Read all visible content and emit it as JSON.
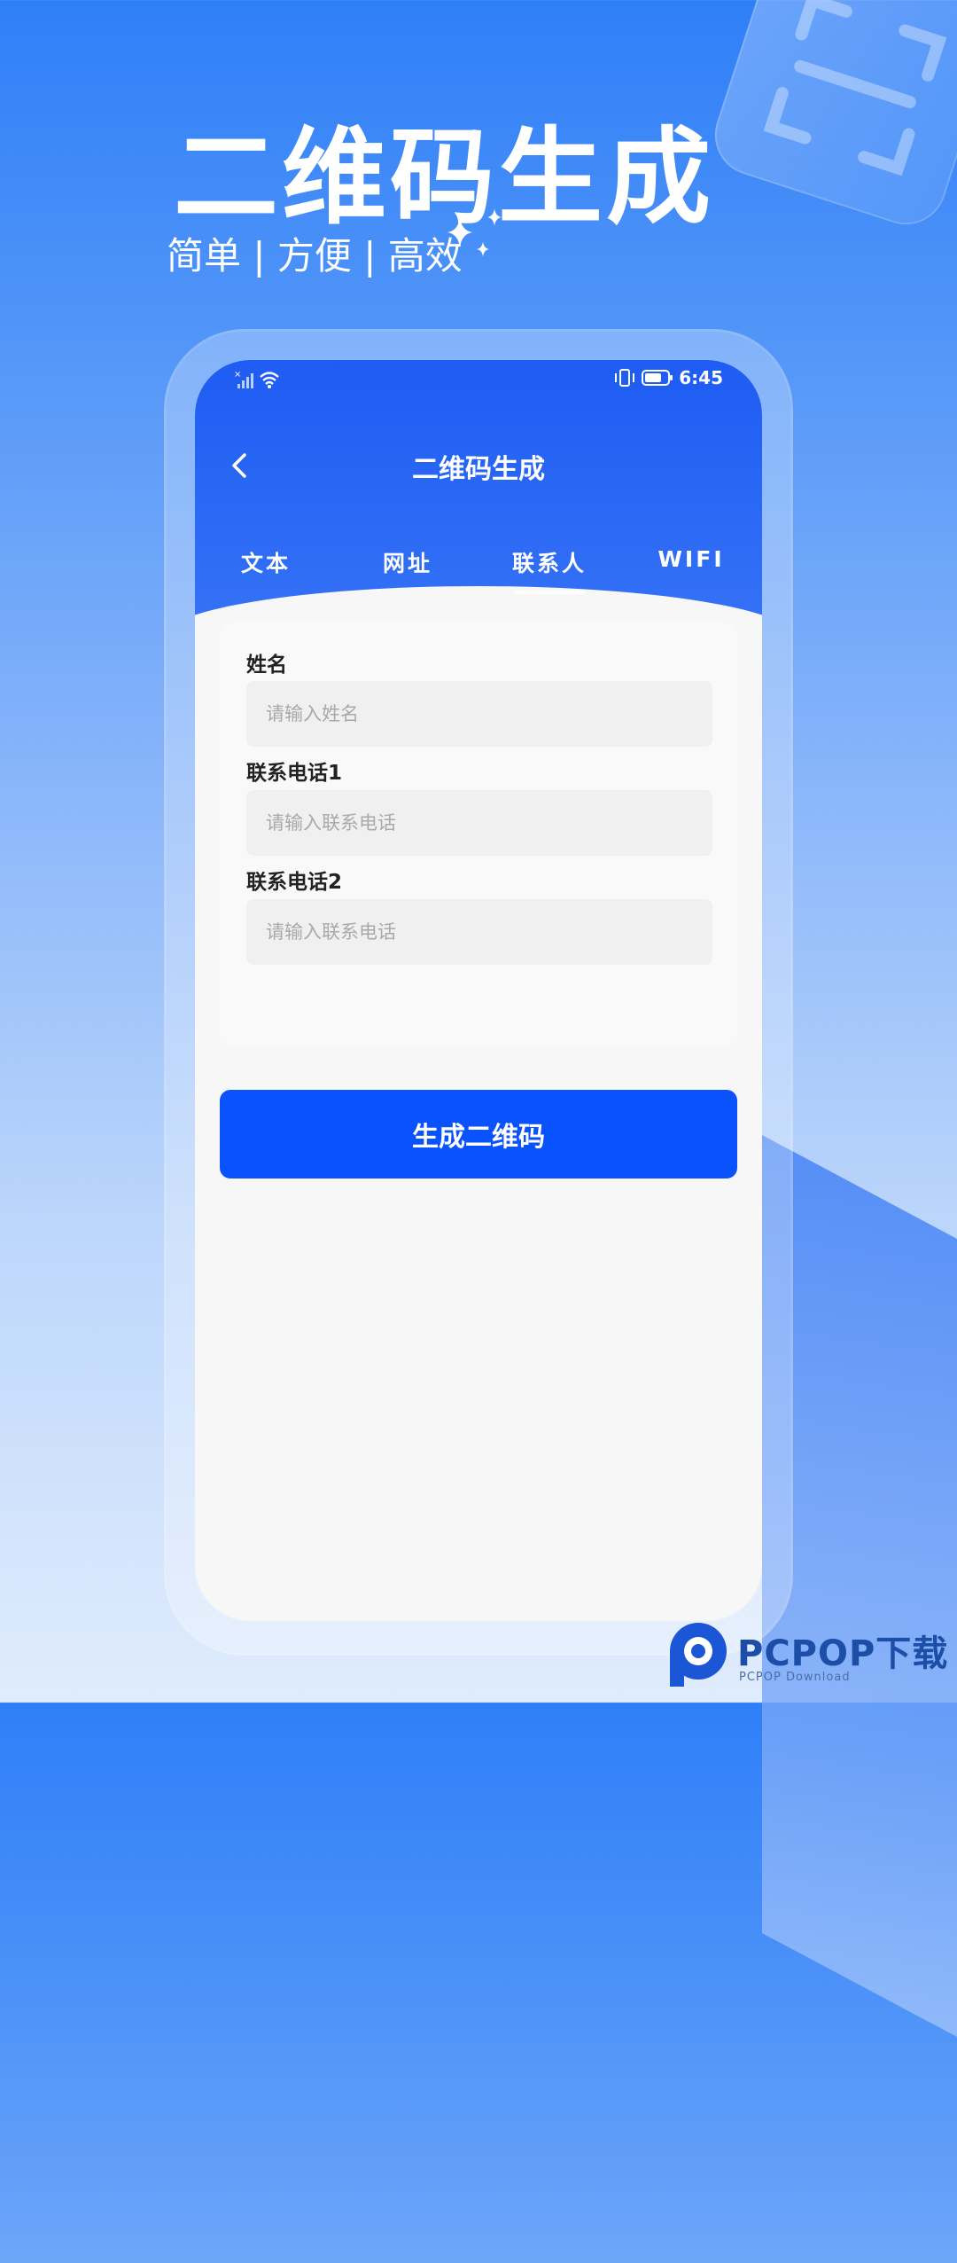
{
  "hero": {
    "title": "二维码生成",
    "subtitle": "简单 | 方便 | 高效"
  },
  "status_bar": {
    "time": "6:45"
  },
  "app": {
    "title": "二维码生成",
    "tabs": [
      {
        "label": "文本",
        "active": false
      },
      {
        "label": "网址",
        "active": false
      },
      {
        "label": "联系人",
        "active": true
      },
      {
        "label": "WIFI",
        "active": false
      }
    ]
  },
  "form": {
    "fields": [
      {
        "label": "姓名",
        "placeholder": "请输入姓名",
        "value": ""
      },
      {
        "label": "联系电话1",
        "placeholder": "请输入联系电话",
        "value": ""
      },
      {
        "label": "联系电话2",
        "placeholder": "请输入联系电话",
        "value": ""
      }
    ],
    "submit_label": "生成二维码"
  },
  "watermark": {
    "text": "PCPOP下载",
    "sub": "PCPOP Download"
  },
  "colors": {
    "primary": "#0a52fc",
    "header": "#1e5cf3"
  }
}
